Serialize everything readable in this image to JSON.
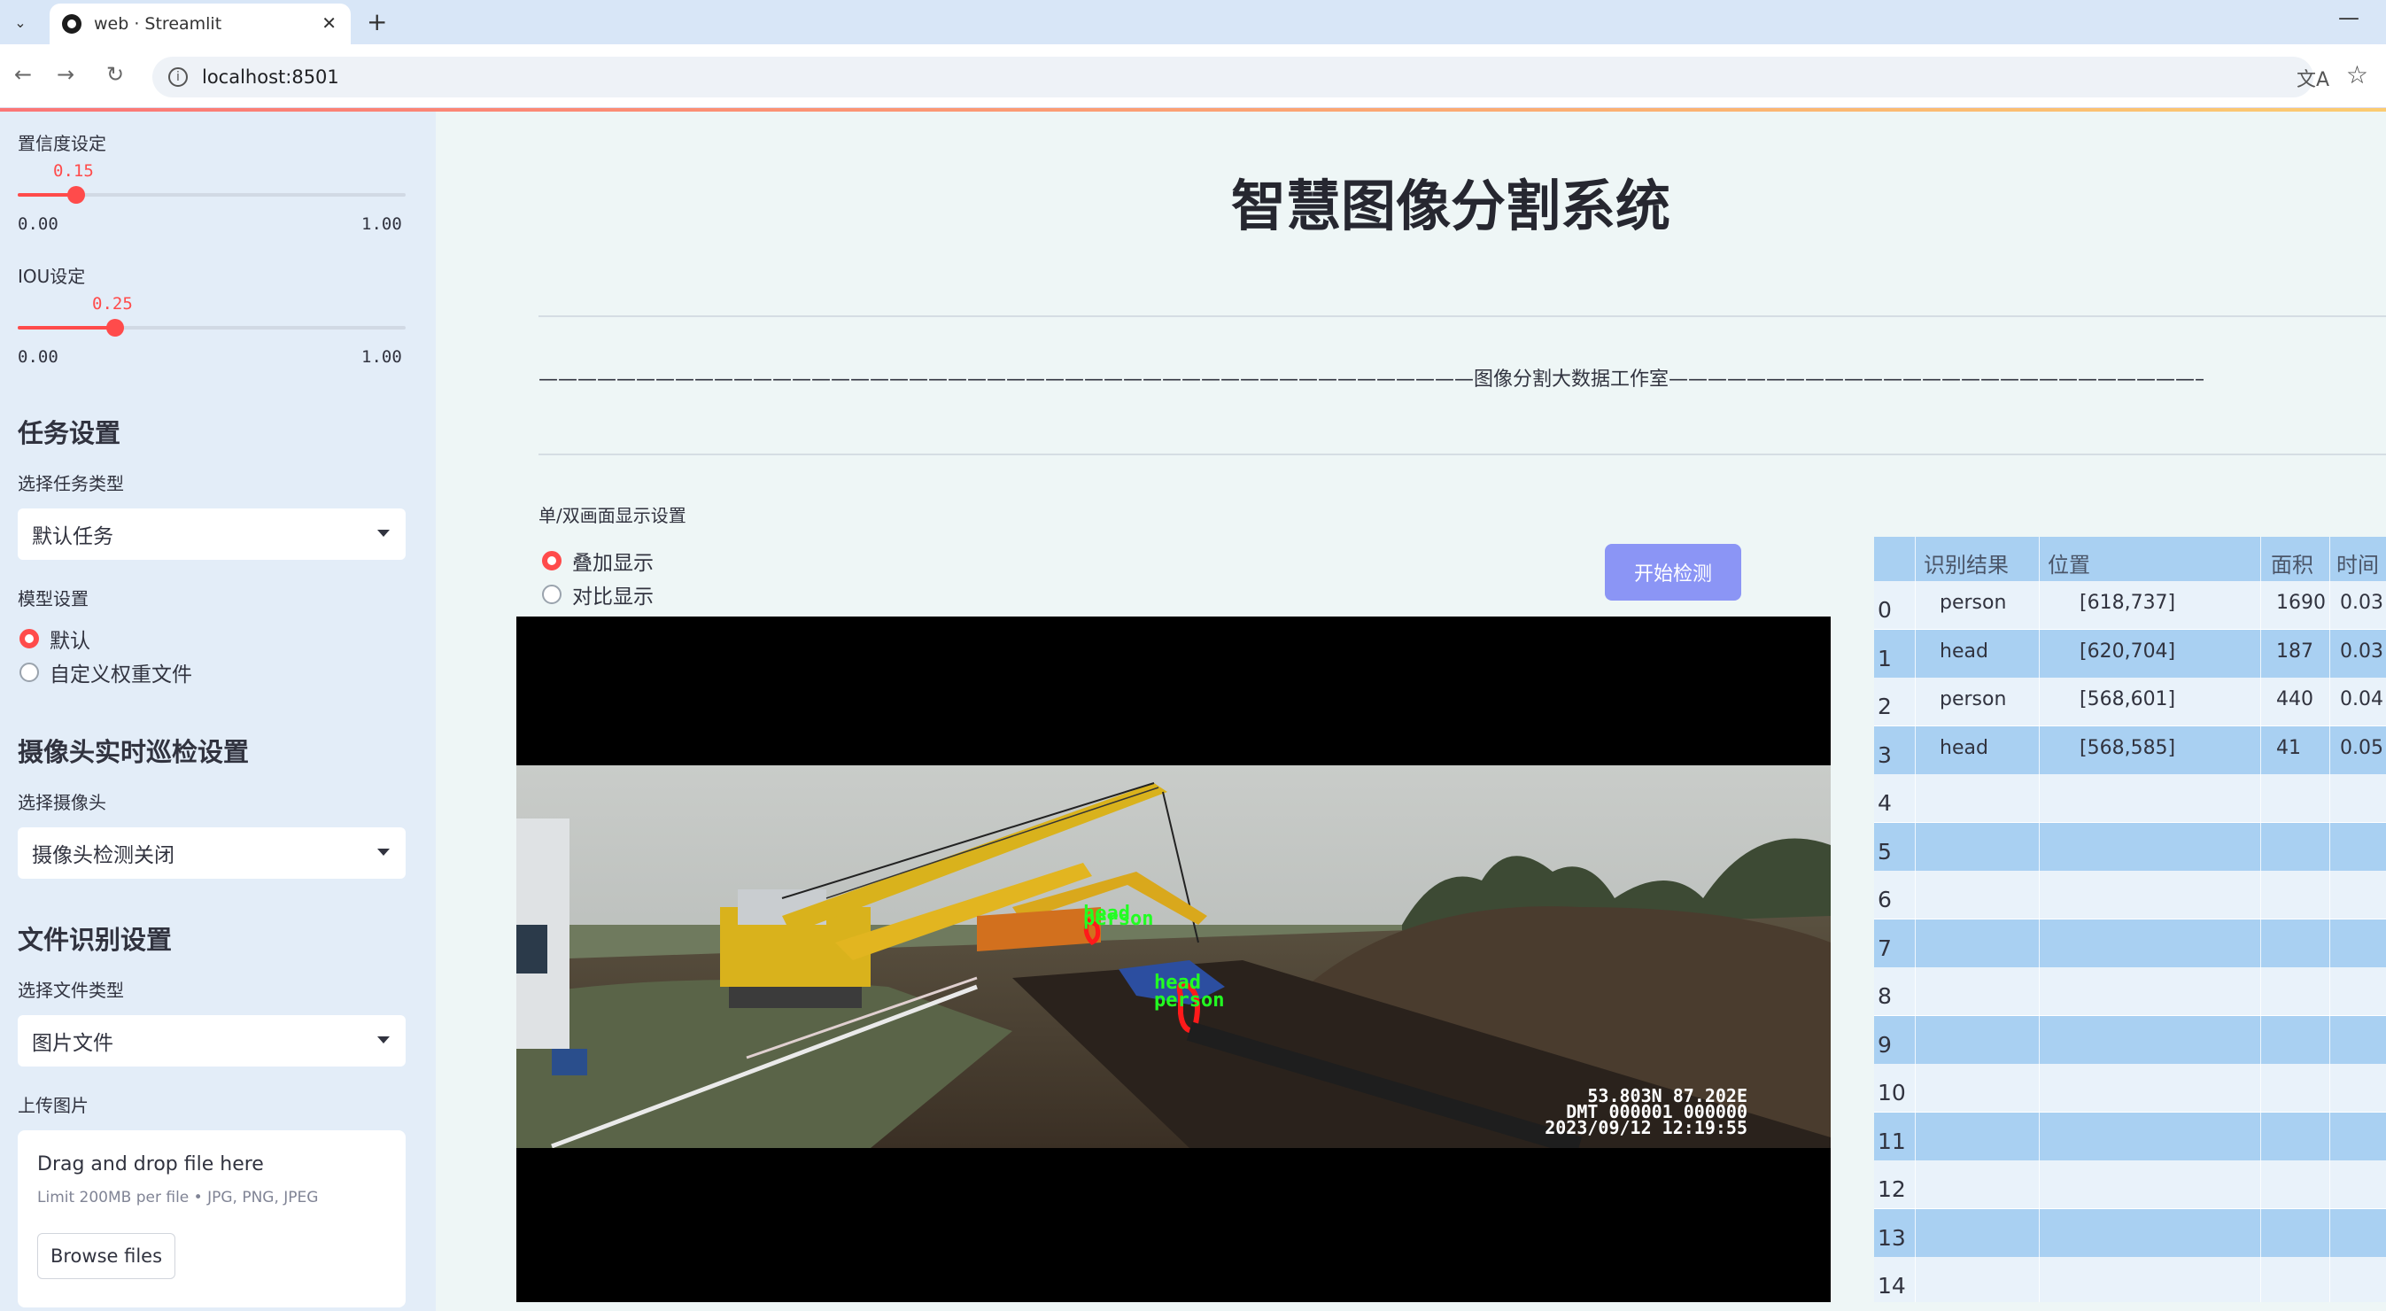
{
  "browser": {
    "tab_title": "web · Streamlit",
    "url": "localhost:8501"
  },
  "sidebar": {
    "confidence": {
      "label": "置信度设定",
      "value": "0.15",
      "min": "0.00",
      "max": "1.00",
      "fraction": 0.15
    },
    "iou": {
      "label": "IOU设定",
      "value": "0.25",
      "min": "0.00",
      "max": "1.00",
      "fraction": 0.25
    },
    "task_heading": "任务设置",
    "task_type_label": "选择任务类型",
    "task_type_value": "默认任务",
    "model_label": "模型设置",
    "model_options": [
      "默认",
      "自定义权重文件"
    ],
    "camera_heading": "摄像头实时巡检设置",
    "camera_label": "选择摄像头",
    "camera_value": "摄像头检测关闭",
    "file_heading": "文件识别设置",
    "file_type_label": "选择文件类型",
    "file_type_value": "图片文件",
    "upload_label": "上传图片",
    "upload_title": "Drag and drop file here",
    "upload_limit": "Limit 200MB per file • JPG, PNG, JPEG",
    "browse_label": "Browse files"
  },
  "main": {
    "title": "智慧图像分割系统",
    "studio_text": "————————————————————————————————————————————————图像分割大数据工作室————————————————————————————————————————————————",
    "mode_label": "单/双画面显示设置",
    "mode_options": [
      "叠加显示",
      "对比显示"
    ],
    "start_button": "开始检测",
    "detections": [
      {
        "label": "head",
        "label2": "person"
      },
      {
        "label": "head",
        "label2": "person"
      }
    ],
    "stamp_lines": [
      "53.803N  87.202E",
      "DMT 000001 000000",
      "2023/09/12 12:19:55"
    ]
  },
  "table": {
    "headers": [
      "识别结果",
      "位置",
      "面积",
      "时间"
    ],
    "rows": [
      {
        "idx": "0",
        "result": "person",
        "pos": "[618,737]",
        "area": "1690",
        "time": "0.03"
      },
      {
        "idx": "1",
        "result": "head",
        "pos": "[620,704]",
        "area": "187",
        "time": "0.03"
      },
      {
        "idx": "2",
        "result": "person",
        "pos": "[568,601]",
        "area": "440",
        "time": "0.04"
      },
      {
        "idx": "3",
        "result": "head",
        "pos": "[568,585]",
        "area": "41",
        "time": "0.05"
      },
      {
        "idx": "4"
      },
      {
        "idx": "5"
      },
      {
        "idx": "6"
      },
      {
        "idx": "7"
      },
      {
        "idx": "8"
      },
      {
        "idx": "9"
      },
      {
        "idx": "10"
      },
      {
        "idx": "11"
      },
      {
        "idx": "12"
      },
      {
        "idx": "13"
      },
      {
        "idx": "14"
      }
    ]
  }
}
